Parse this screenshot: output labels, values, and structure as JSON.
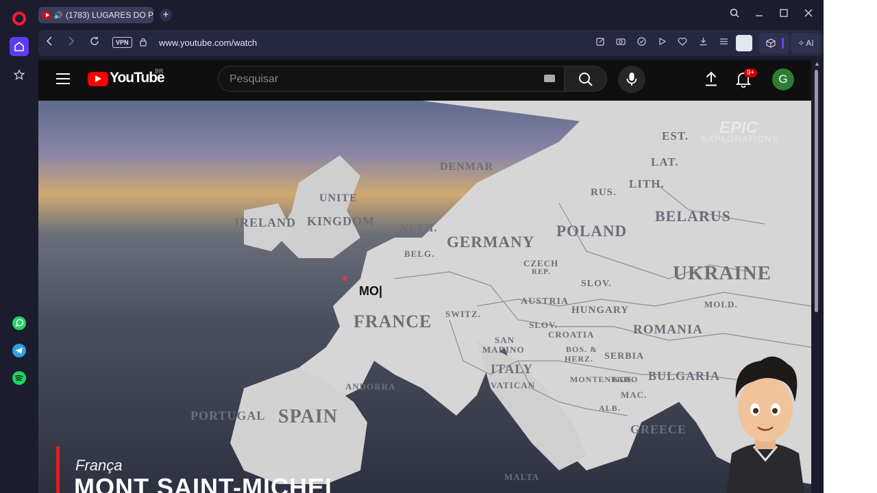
{
  "browser": {
    "tab_title": "(1783) LUGARES DO P",
    "new_tab": "+",
    "address_url": "www.youtube.com/watch",
    "vpn_label": "VPN",
    "ai_label": "AI",
    "window_controls": [
      "minimize-icon",
      "maximize-icon",
      "close-icon"
    ],
    "sidebar_apps": [
      "opera-icon",
      "home-icon",
      "star-icon",
      "whatsapp-icon",
      "telegram-icon",
      "spotify-icon"
    ]
  },
  "youtube": {
    "logo_text": "YouTube",
    "region": "BR",
    "search_placeholder": "Pesquisar",
    "notif_badge": "9+",
    "avatar_letter": "G"
  },
  "video": {
    "watermark_main": "EPIC",
    "watermark_sub": "EXPLORATIONS",
    "typing_text": "MO|",
    "caption_country": "França",
    "caption_title": "MONT SAINT-MICHEL",
    "map_labels": [
      "EST.",
      "LAT.",
      "LITH.",
      "RUS.",
      "DENMAR",
      "UNITE",
      "KINGDOM",
      "IRELAND",
      "NETH.",
      "BELG.",
      "GERMANY",
      "POLAND",
      "BELARUS",
      "CZECH",
      "REP.",
      "SLOV.",
      "UKRAINE",
      "AUSTRIA",
      "HUNGARY",
      "MOLD.",
      "SWITZ.",
      "SLOV.",
      "ROMANIA",
      "FRANCE",
      "CROATIA",
      "BOS. &",
      "HERZ.",
      "SERBIA",
      "SAN",
      "MARINO",
      "ITALY",
      "VATICAN",
      "MONTENEGRO",
      "KOS.",
      "BULGARIA",
      "MAC.",
      "ALB.",
      "GREECE",
      "ANDORRA",
      "PORTUGAL",
      "SPAIN",
      "MALTA"
    ]
  }
}
